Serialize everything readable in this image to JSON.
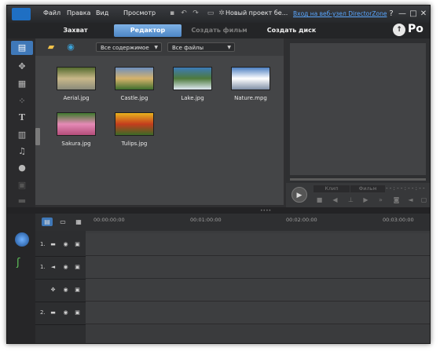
{
  "titlebar": {
    "menus": [
      "Файл",
      "Правка",
      "Вид",
      "Просмотр"
    ],
    "project_title": "Новый проект бе...",
    "directorzone_link": "Вход на веб-узел DirectorZone",
    "help_label": "?",
    "minimize_label": "—",
    "maximize_label": "□",
    "close_label": "✕"
  },
  "modes": {
    "capture": "Захват",
    "edit": "Редактор",
    "produce": "Создать фильм",
    "create_disc": "Создать диск",
    "logo_text": "Po"
  },
  "library": {
    "filter_content": "Все содержимое",
    "filter_files": "Все файлы",
    "items": [
      {
        "name": "Aerial.jpg",
        "colors": [
          "#556b2f",
          "#c9b88a",
          "#8a8a7a"
        ]
      },
      {
        "name": "Castle.jpg",
        "colors": [
          "#6e8fbe",
          "#d6b36b",
          "#3e6e2e"
        ]
      },
      {
        "name": "Lake.jpg",
        "colors": [
          "#3c7bb8",
          "#4e7a3c",
          "#dfe9f2"
        ]
      },
      {
        "name": "Nature.mpg",
        "colors": [
          "#4c7fc2",
          "#ffffff",
          "#7f8fa6"
        ]
      },
      {
        "name": "Sakura.jpg",
        "colors": [
          "#3f7a2e",
          "#e58ab6",
          "#b44d7a"
        ]
      },
      {
        "name": "Tulips.jpg",
        "colors": [
          "#e8b21e",
          "#c43d1d",
          "#3b6b27"
        ]
      }
    ]
  },
  "preview": {
    "clip_tab": "Клип",
    "movie_tab": "Фильм",
    "timecode": "- - : - - : - - : - -"
  },
  "timeline": {
    "ruler": [
      "00:00:00:00",
      "00:01:00:00",
      "00:02:00:00",
      "00:03:00:00"
    ],
    "tracks": [
      {
        "label": "1.",
        "icon": "video-track-icon"
      },
      {
        "label": "1.",
        "icon": "audio-track-icon"
      },
      {
        "label": "",
        "icon": "fx-track-icon"
      },
      {
        "label": "2.",
        "icon": "video-track-icon"
      }
    ]
  },
  "icons": {
    "colors": {
      "accent": "#4d86c5",
      "link": "#5aa7ff",
      "window_bg": "#2f2f31"
    }
  }
}
